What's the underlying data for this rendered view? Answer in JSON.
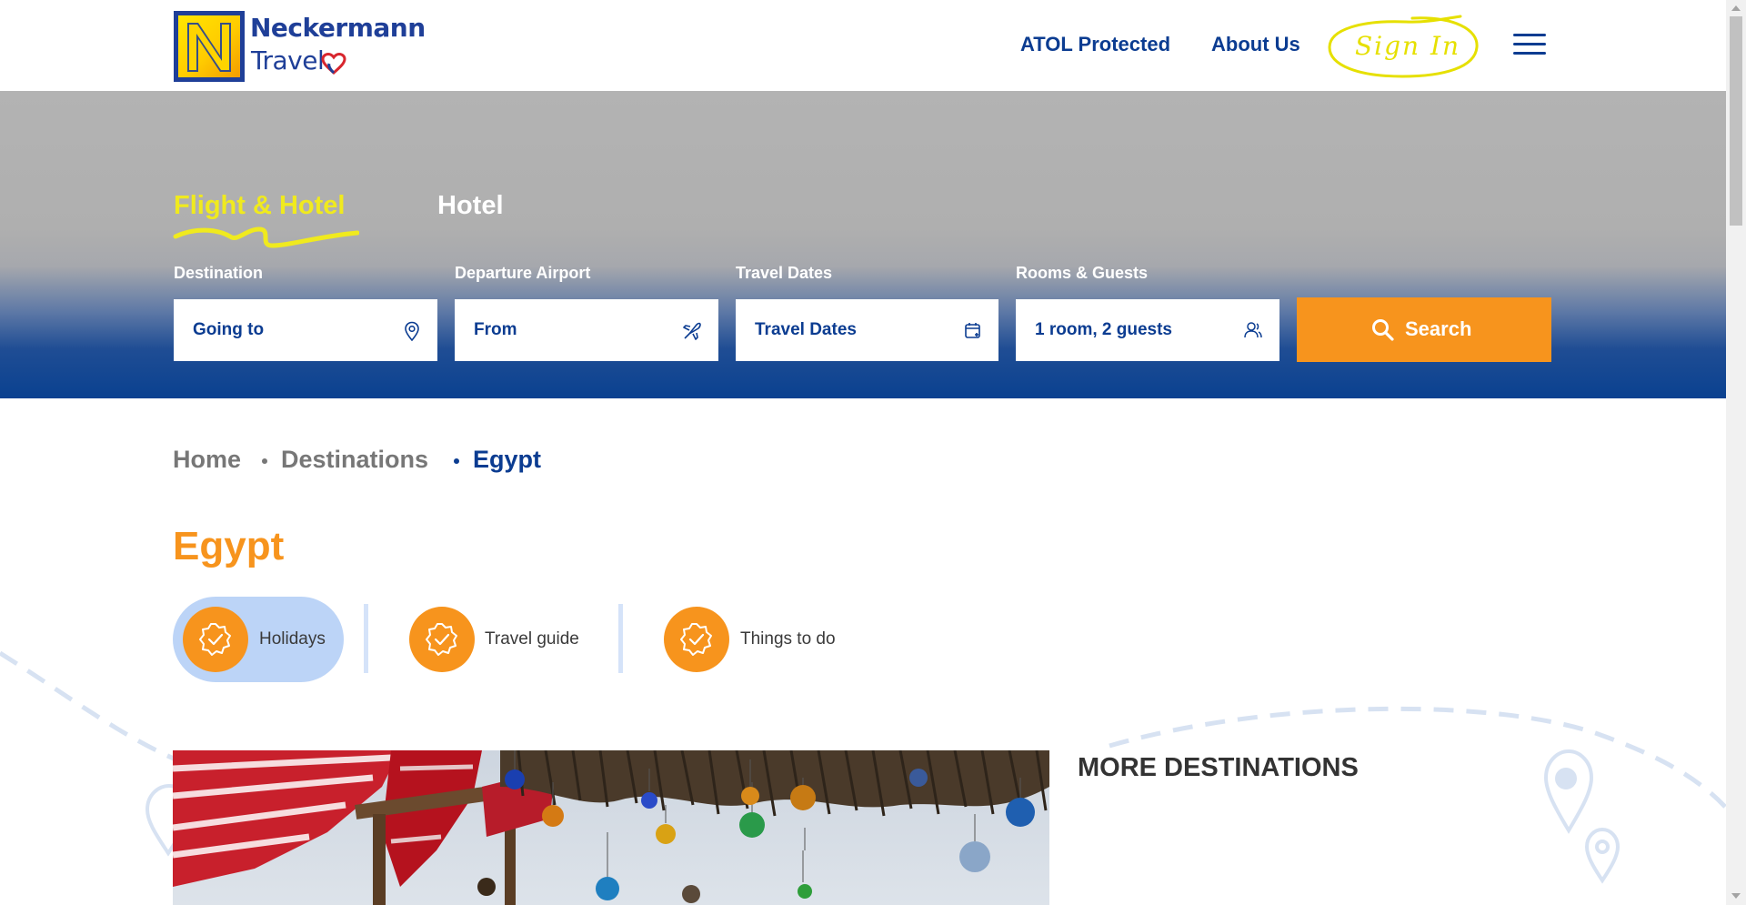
{
  "header": {
    "logo_line1": "Neckermann",
    "logo_line2": "Travel",
    "nav": {
      "atol": "ATOL Protected",
      "about": "About Us",
      "sign_in": "Sign In"
    },
    "menu_icon": "hamburger-icon"
  },
  "search": {
    "tabs": {
      "flight_hotel": "Flight & Hotel",
      "hotel": "Hotel"
    },
    "active_tab": "Flight & Hotel",
    "fields": {
      "destination": {
        "label": "Destination",
        "value": "Going to",
        "icon": "map-pin-icon"
      },
      "departure": {
        "label": "Departure Airport",
        "value": "From",
        "icon": "plane-icon"
      },
      "dates": {
        "label": "Travel Dates",
        "value": "Travel Dates",
        "icon": "calendar-icon"
      },
      "guests": {
        "label": "Rooms & Guests",
        "value": "1 room, 2 guests",
        "icon": "user-icon"
      }
    },
    "button": "Search"
  },
  "breadcrumb": {
    "home": "Home",
    "destinations": "Destinations",
    "current": "Egypt"
  },
  "page_title": "Egypt",
  "subtabs": {
    "holidays": "Holidays",
    "guide": "Travel guide",
    "todo": "Things to do"
  },
  "more_destinations": "MORE DESTINATIONS",
  "colors": {
    "brand_blue": "#0b3c91",
    "accent_orange": "#f7941d",
    "highlight_yellow": "#f0ea1e",
    "active_subtab": "#bcd4f7"
  }
}
